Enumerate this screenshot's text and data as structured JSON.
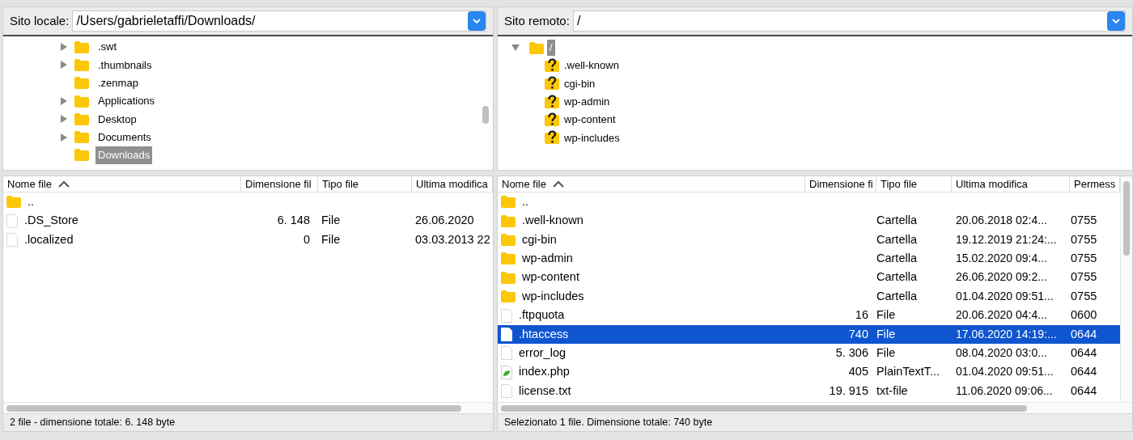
{
  "local": {
    "label": "Sito locale:",
    "path": "/Users/gabrieletaffi/Downloads/",
    "tree": [
      {
        "name": ".swt",
        "expandable": true,
        "selected": false
      },
      {
        "name": ".thumbnails",
        "expandable": true,
        "selected": false
      },
      {
        "name": ".zenmap",
        "expandable": false,
        "selected": false
      },
      {
        "name": "Applications",
        "expandable": true,
        "selected": false
      },
      {
        "name": "Desktop",
        "expandable": true,
        "selected": false
      },
      {
        "name": "Documents",
        "expandable": true,
        "selected": false
      },
      {
        "name": "Downloads",
        "expandable": false,
        "selected": true
      }
    ],
    "columns": [
      "Nome file",
      "Dimensione fil",
      "Tipo file",
      "Ultima modifica"
    ],
    "rows": [
      {
        "kind": "folder",
        "name": "..",
        "size": "",
        "type": "",
        "modified": ""
      },
      {
        "kind": "file",
        "name": ".DS_Store",
        "size": "6. 148",
        "type": "File",
        "modified": "26.06.2020"
      },
      {
        "kind": "file",
        "name": ".localized",
        "size": "0",
        "type": "File",
        "modified": "03.03.2013 22"
      }
    ],
    "status": "2 file - dimensione totale: 6. 148 byte"
  },
  "remote": {
    "label": "Sito remoto:",
    "path": "/",
    "tree": [
      {
        "name": "/",
        "expanded": true,
        "selected": true,
        "children": [
          {
            "name": ".well-known",
            "kind": "unknown"
          },
          {
            "name": "cgi-bin",
            "kind": "unknown"
          },
          {
            "name": "wp-admin",
            "kind": "unknown"
          },
          {
            "name": "wp-content",
            "kind": "unknown"
          },
          {
            "name": "wp-includes",
            "kind": "unknown"
          }
        ]
      }
    ],
    "columns": [
      "Nome file",
      "Dimensione fi",
      "Tipo file",
      "Ultima modifica",
      "Permess"
    ],
    "rows": [
      {
        "kind": "folder",
        "name": "..",
        "size": "",
        "type": "",
        "modified": "",
        "permissions": "",
        "selected": false
      },
      {
        "kind": "folder",
        "name": ".well-known",
        "size": "",
        "type": "Cartella",
        "modified": "20.06.2018 02:4...",
        "permissions": "0755",
        "selected": false
      },
      {
        "kind": "folder",
        "name": "cgi-bin",
        "size": "",
        "type": "Cartella",
        "modified": "19.12.2019 21:24:...",
        "permissions": "0755",
        "selected": false
      },
      {
        "kind": "folder",
        "name": "wp-admin",
        "size": "",
        "type": "Cartella",
        "modified": "15.02.2020 09:4...",
        "permissions": "0755",
        "selected": false
      },
      {
        "kind": "folder",
        "name": "wp-content",
        "size": "",
        "type": "Cartella",
        "modified": "26.06.2020 09:2...",
        "permissions": "0755",
        "selected": false
      },
      {
        "kind": "folder",
        "name": "wp-includes",
        "size": "",
        "type": "Cartella",
        "modified": "01.04.2020 09:51...",
        "permissions": "0755",
        "selected": false
      },
      {
        "kind": "file",
        "name": ".ftpquota",
        "size": "16",
        "type": "File",
        "modified": "20.06.2020 04:4...",
        "permissions": "0600",
        "selected": false
      },
      {
        "kind": "file",
        "name": ".htaccess",
        "size": "740",
        "type": "File",
        "modified": "17.06.2020 14:19:...",
        "permissions": "0644",
        "selected": true
      },
      {
        "kind": "file",
        "name": "error_log",
        "size": "5. 306",
        "type": "File",
        "modified": "08.04.2020 03:0...",
        "permissions": "0644",
        "selected": false
      },
      {
        "kind": "php",
        "name": "index.php",
        "size": "405",
        "type": "PlainTextT...",
        "modified": "01.04.2020 09:51...",
        "permissions": "0644",
        "selected": false
      },
      {
        "kind": "file",
        "name": "license.txt",
        "size": "19. 915",
        "type": "txt-file",
        "modified": "11.06.2020 09:06...",
        "permissions": "0644",
        "selected": false
      }
    ],
    "status": "Selezionato 1 file. Dimensione totale: 740 byte"
  }
}
